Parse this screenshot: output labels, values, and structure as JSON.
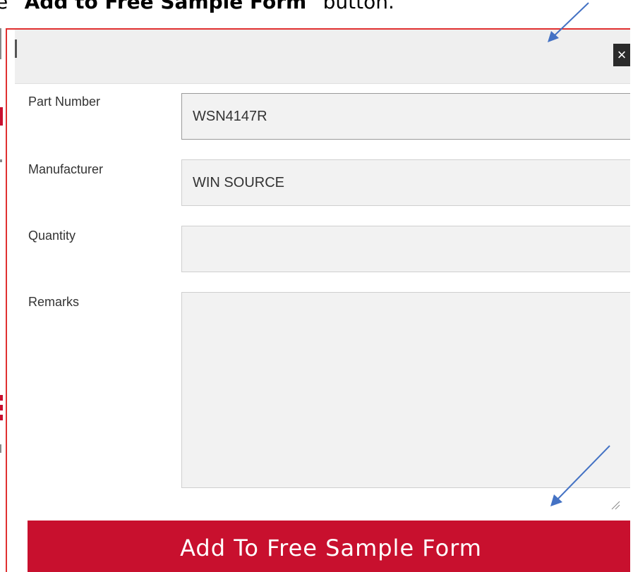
{
  "caption": {
    "prefix": "e “",
    "bold": "Add to Free Sample Form",
    "suffix": "” button."
  },
  "modal": {
    "close_label": "×",
    "fields": {
      "part_number": {
        "label": "Part Number",
        "value": "WSN4147R"
      },
      "manufacturer": {
        "label": "Manufacturer",
        "value": "WIN SOURCE"
      },
      "quantity": {
        "label": "Quantity",
        "value": ""
      },
      "remarks": {
        "label": "Remarks",
        "value": ""
      }
    },
    "submit_label": "Add To Free Sample Form"
  },
  "colors": {
    "brand_red": "#c8102e",
    "highlight_border": "#e03030",
    "annotation_arrow": "#4472c4"
  },
  "icons": [
    "close-icon",
    "resize-grip-icon",
    "annotation-arrow-icon"
  ]
}
